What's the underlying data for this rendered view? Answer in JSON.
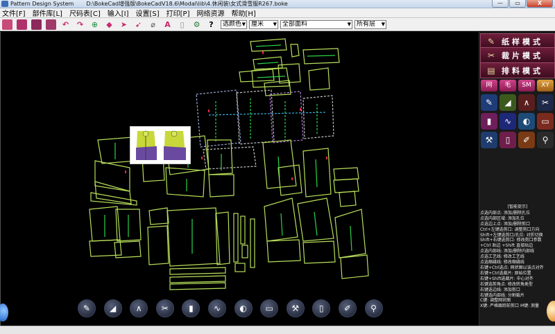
{
  "window": {
    "app_name": "Pattern Design System",
    "file_path": "D:\\BokeCad增强版\\BokeCadV18.6\\Modal\\lib\\4.休闲装\\女式滑雪服R267.boke",
    "buttons": {
      "minimize": "—",
      "maximize": "▭",
      "close": "X"
    }
  },
  "menu": [
    "文件[F]",
    "部件库[L]",
    "尺码表[C]",
    "输入[I]",
    "设置[S]",
    "打印[P]",
    "网络资源",
    "帮助[H]"
  ],
  "toolbar": {
    "icons": [
      "open-file-icon",
      "folder-icon",
      "save-icon",
      "print-icon",
      "undo-icon",
      "redo-icon",
      "zoom-icon",
      "fill-icon",
      "pick-arrow-icon",
      "select-arrow-icon",
      "lasso-icon",
      "text-a-icon",
      "ruler-icon",
      "grid-icon",
      "help-icon"
    ],
    "help_glyph": "?",
    "text_glyph": "A",
    "color_select": "选颜色",
    "unit_select": "厘米",
    "fabric_select": "全部面料",
    "layer_select": "所有层"
  },
  "right_panel": {
    "modes": [
      {
        "label": "纸样模式",
        "icon": "pattern-mode-icon",
        "glyph": "✎"
      },
      {
        "label": "裁片模式",
        "icon": "cut-mode-icon",
        "glyph": "✂"
      },
      {
        "label": "排料模式",
        "icon": "marker-mode-icon",
        "glyph": "▤"
      }
    ],
    "size_buttons": [
      "网",
      "毛",
      "SM",
      "XY"
    ],
    "tools": [
      {
        "name": "pencil-tool-icon",
        "glyph": "✎",
        "color": "#1e3c78"
      },
      {
        "name": "ruler-tool-icon",
        "glyph": "◢",
        "color": "#3c5a1e"
      },
      {
        "name": "compass-tool-icon",
        "glyph": "∧",
        "color": "#5a1e1e"
      },
      {
        "name": "scissors-tool-icon",
        "glyph": "✂",
        "color": "#1e2848"
      },
      {
        "name": "book-tool-icon",
        "glyph": "▮",
        "color": "#6e1e5a"
      },
      {
        "name": "curve-tool-icon",
        "glyph": "∿",
        "color": "#1e2878"
      },
      {
        "name": "dart-tool-icon",
        "glyph": "◐",
        "color": "#1e4a78"
      },
      {
        "name": "label-tool-icon",
        "glyph": "▭",
        "color": "#7a2a1e"
      },
      {
        "name": "hammer-tool-icon",
        "glyph": "⚒",
        "color": "#1e3c6e"
      },
      {
        "name": "notebook-tool-icon",
        "glyph": "▯",
        "color": "#6e1e4a"
      },
      {
        "name": "brush-tool-icon",
        "glyph": "✐",
        "color": "#7a3a14"
      },
      {
        "name": "pin-tool-icon",
        "glyph": "⚲",
        "color": "#2a2a2a"
      }
    ],
    "tips_title": "[智能提示]",
    "tips": [
      "点选内部点: 添加/删除孔位",
      "点选内部区域: 添加孔位",
      "点选边上点: 添加/删除剪口",
      "Ctrl+左键选剪口: 调整剪口方向",
      "Shift+左键选剪口/孔位: 对折切换",
      "Shift+右键选剪口: 修改剪口参数",
      "+Ctrl 贴边  +Shift 直接贴边",
      "点选内部线: 添加/删除内部线",
      "点选工艺线: 修改工艺线",
      "点选缩缝线: 修改缩缝线",
      "右键+Ctrl选点: 网状图以该点对齐",
      "右键+Ctrl选裁片: 原始位置",
      "右键+Shift选裁片: 中心对齐",
      "右键选剪角点: 修改转角类型",
      "右键选边线: 添加剪口",
      "右键选内部线: 分割裁片",
      "C键: 调整网状图",
      "X键: 严格跟踪前剪口   M键: 测量"
    ]
  },
  "bottom_tools": [
    {
      "name": "pencil-tool-icon",
      "glyph": "✎"
    },
    {
      "name": "triangle-ruler-icon",
      "glyph": "◢"
    },
    {
      "name": "compass-icon",
      "glyph": "∧"
    },
    {
      "name": "scissors-icon",
      "glyph": "✂"
    },
    {
      "name": "book-icon",
      "glyph": "▮"
    },
    {
      "name": "curve-pen-icon",
      "glyph": "∿"
    },
    {
      "name": "dart-icon",
      "glyph": "◐"
    },
    {
      "name": "label-icon",
      "glyph": "▭"
    },
    {
      "name": "hammer-icon",
      "glyph": "⚒"
    },
    {
      "name": "notebook-icon",
      "glyph": "▯"
    },
    {
      "name": "brush-icon",
      "glyph": "✐"
    },
    {
      "name": "pin-icon",
      "glyph": "⚲"
    }
  ]
}
